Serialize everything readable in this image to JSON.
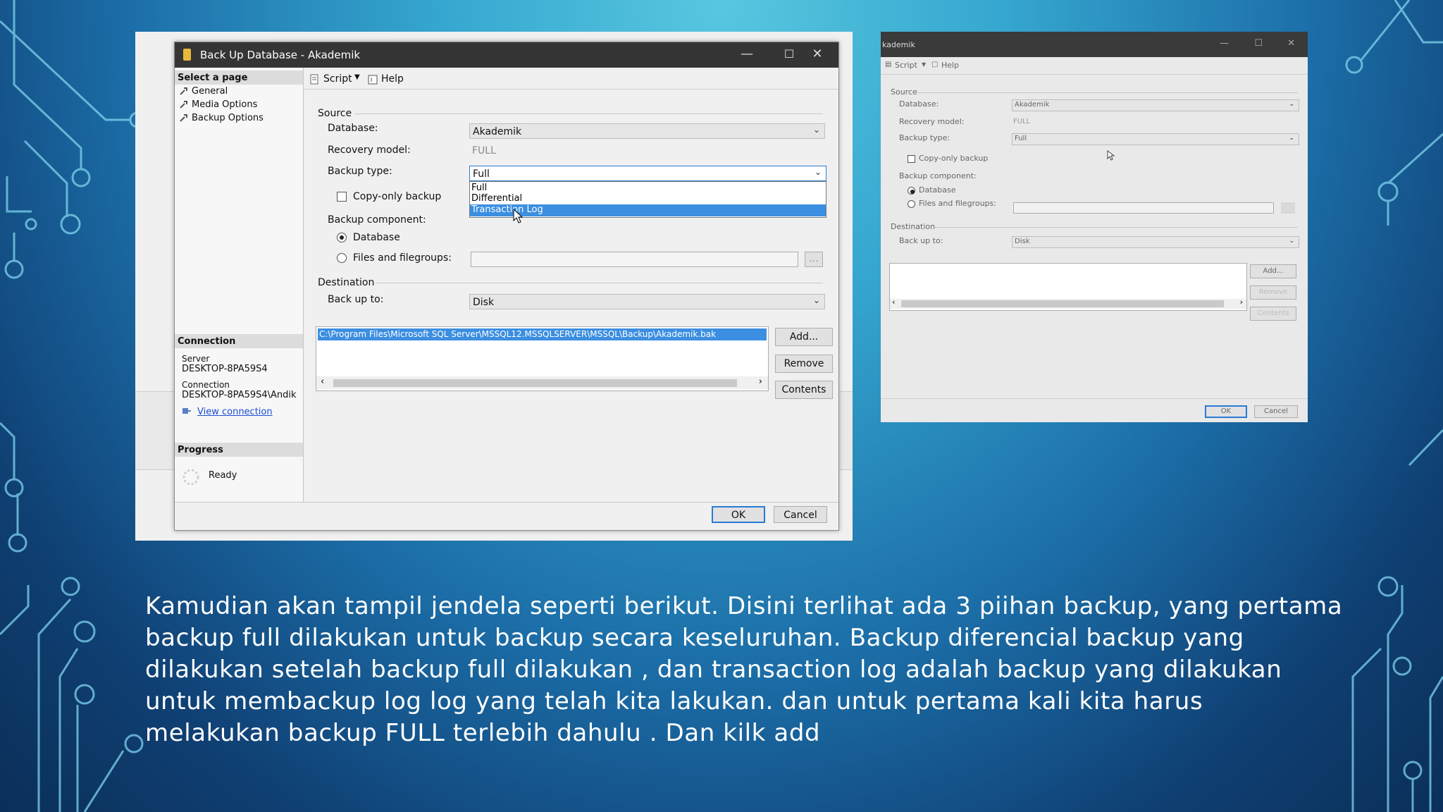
{
  "dialog": {
    "title": "Back Up Database - Akademik",
    "title_right": "kademik",
    "window_controls": {
      "minimize": "—",
      "maximize": "☐",
      "close": "✕"
    },
    "toolbar": {
      "script": "Script",
      "help": "Help"
    },
    "left_pane": {
      "select_page_header": "Select a page",
      "pages": [
        "General",
        "Media Options",
        "Backup Options"
      ],
      "connection_header": "Connection",
      "server_label": "Server",
      "server_value": "DESKTOP-8PA59S4",
      "connection_label": "Connection",
      "connection_value": "DESKTOP-8PA59S4\\Andik",
      "view_connection": "View connection",
      "progress_header": "Progress",
      "progress_status": "Ready"
    },
    "source": {
      "group_label": "Source",
      "database_label": "Database:",
      "database_value": "Akademik",
      "recovery_model_label": "Recovery model:",
      "recovery_model_value": "FULL",
      "backup_type_label": "Backup type:",
      "backup_type_value": "Full",
      "backup_type_options": [
        "Full",
        "Differential",
        "Transaction Log"
      ],
      "highlighted_option": "Transaction Log",
      "copy_only_label": "Copy-only backup",
      "copy_only_checked": false,
      "backup_component_label": "Backup component:",
      "component_database": "Database",
      "component_files": "Files and filegroups:",
      "selected_component": "Database",
      "browse_label": "..."
    },
    "destination": {
      "group_label": "Destination",
      "back_up_to_label": "Back up to:",
      "back_up_to_value": "Disk",
      "path": "C:\\Program Files\\Microsoft SQL Server\\MSSQL12.MSSQLSERVER\\MSSQL\\Backup\\Akademik.bak",
      "add_button": "Add...",
      "remove_button": "Remove",
      "contents_button": "Contents"
    },
    "ok_button": "OK",
    "cancel_button": "Cancel"
  },
  "caption": "Kamudian akan tampil jendela seperti berikut. Disini terlihat ada 3 piihan backup, yang pertama backup full dilakukan untuk backup secara keseluruhan. Backup diferencial backup yang dilakukan setelah backup full dilakukan , dan transaction log adalah backup yang dilakukan untuk membackup log log yang telah kita lakukan. dan untuk pertama kali kita harus melakukan backup FULL terlebih dahulu . Dan kilk add",
  "colors": {
    "accent": "#2a7ad5",
    "highlight": "#3b8ee0",
    "titlebar": "#353535"
  }
}
